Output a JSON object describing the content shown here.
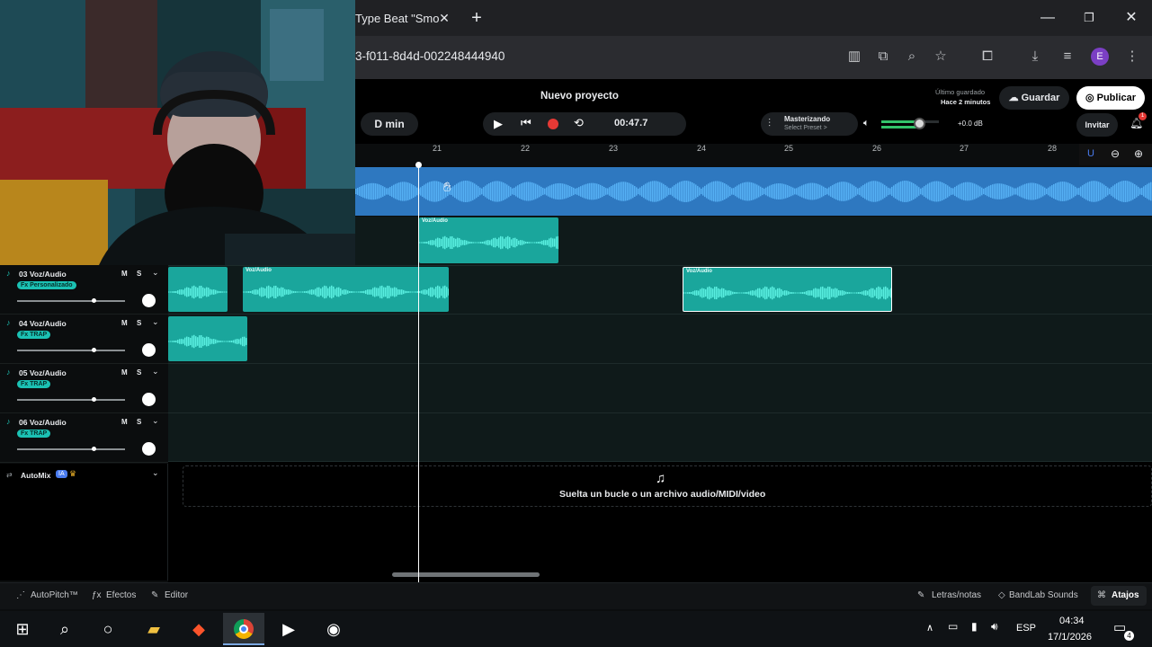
{
  "browser": {
    "tab_title": "Type Beat \"Smo",
    "url": "3-f011-8d4d-002248444940",
    "profile_initial": "E"
  },
  "header": {
    "project_title": "Nuevo proyecto",
    "key": "D min",
    "time": "00:47.7",
    "mastering_label": "Masterizando",
    "mastering_preset": "Select Preset >",
    "db": "+0.0 dB",
    "last_saved_label": "Último guardado",
    "last_saved_time": "Hace 2 minutos",
    "save_label": "Guardar",
    "publish_label": "Publicar",
    "invite_label": "Invitar",
    "notif_count": "1"
  },
  "ruler": {
    "marks": [
      "21",
      "22",
      "23",
      "24",
      "25",
      "26",
      "27",
      "28"
    ]
  },
  "tracks": [
    {
      "name": "03 Voz/Audio",
      "fx": "Fx Personalizado",
      "m": "M",
      "s": "S"
    },
    {
      "name": "04 Voz/Audio",
      "fx": "Fx TRAP",
      "m": "M",
      "s": "S"
    },
    {
      "name": "05 Voz/Audio",
      "fx": "Fx TRAP",
      "m": "M",
      "s": "S"
    },
    {
      "name": "06 Voz/Audio",
      "fx": "Fx TRAP",
      "m": "M",
      "s": "S"
    }
  ],
  "clip_label": "Voz/Audio",
  "automix": {
    "label": "AutoMix",
    "badge": "IA"
  },
  "drop_zone": {
    "text": "Suelta un bucle o un archivo audio/MIDI/video"
  },
  "bottom": {
    "autopitch": "AutoPitch™",
    "effects": "Efectos",
    "editor": "Editor",
    "lyrics": "Letras/notas",
    "sounds": "BandLab Sounds",
    "shortcuts": "Atajos"
  },
  "taskbar": {
    "lang": "ESP",
    "time": "04:34",
    "date": "17/1/2026",
    "notif": "4"
  },
  "colors": {
    "accent": "#1bc1b3",
    "record": "#e53935",
    "waveform_master": "#3f9be0"
  }
}
